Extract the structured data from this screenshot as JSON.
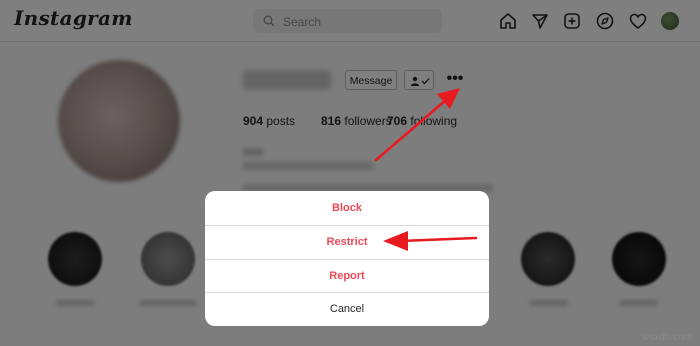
{
  "nav": {
    "logo": "Instagram",
    "search_placeholder": "Search",
    "icons": [
      "home-icon",
      "direct-message-icon",
      "new-post-icon",
      "explore-icon",
      "activity-heart-icon",
      "avatar"
    ]
  },
  "profile": {
    "message_label": "Message",
    "more_label": "•••",
    "stats": {
      "posts_count": "904",
      "posts_label": "posts",
      "followers_count": "816",
      "followers_label": "followers",
      "following_count": "706",
      "following_label": "following"
    }
  },
  "modal": {
    "items": [
      {
        "label": "Block",
        "style": "danger"
      },
      {
        "label": "Restrict",
        "style": "danger"
      },
      {
        "label": "Report",
        "style": "danger"
      },
      {
        "label": "Cancel",
        "style": "plain"
      }
    ]
  },
  "colors": {
    "danger": "#ed4956",
    "annotation_arrow": "#e8191f",
    "overlay": "rgba(0,0,0,0.5)"
  },
  "watermark": "wsxdn.com"
}
